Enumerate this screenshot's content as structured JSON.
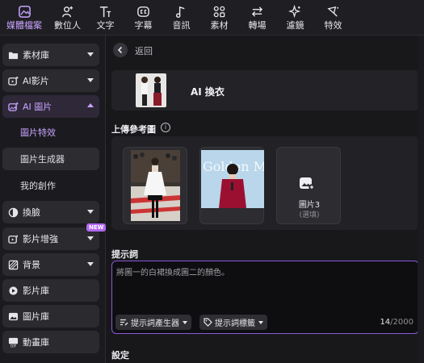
{
  "toolbar": {
    "items": [
      {
        "label": "媒體檔案",
        "icon": "media-icon",
        "active": true
      },
      {
        "label": "數位人",
        "icon": "avatar-add-icon"
      },
      {
        "label": "文字",
        "icon": "text-icon"
      },
      {
        "label": "字幕",
        "icon": "caption-icon"
      },
      {
        "label": "音訊",
        "icon": "music-note-icon"
      },
      {
        "label": "素材",
        "icon": "elements-icon"
      },
      {
        "label": "轉場",
        "icon": "transition-icon"
      },
      {
        "label": "濾鏡",
        "icon": "sparkle-icon"
      },
      {
        "label": "特效",
        "icon": "effects-icon"
      }
    ]
  },
  "sidebar": {
    "items": [
      {
        "label": "素材庫",
        "icon": "folder-icon"
      },
      {
        "label": "AI影片",
        "icon": "ai-video-icon"
      },
      {
        "label": "AI 圖片",
        "icon": "ai-image-icon"
      },
      {
        "label": "換臉",
        "icon": "face-swap-icon"
      },
      {
        "label": "影片增強",
        "icon": "enhance-icon",
        "badge": "NEW"
      },
      {
        "label": "背景",
        "icon": "background-icon"
      },
      {
        "label": "影片庫",
        "icon": "video-library-icon"
      },
      {
        "label": "圖片庫",
        "icon": "image-library-icon"
      },
      {
        "label": "動畫庫",
        "icon": "gif-icon"
      }
    ],
    "subitems": [
      {
        "label": "圖片特效"
      },
      {
        "label": "圖片生成器"
      },
      {
        "label": "我的創作"
      }
    ]
  },
  "main": {
    "back_label": "返回",
    "feature_title": "AI 換衣",
    "upload_title": "上傳參考圖",
    "slot3_label": "圖片3",
    "slot3_sub": "(選填)",
    "slot2_overlay_text": "Golden Music",
    "prompt_title": "提示詞",
    "prompt_value": "將圖一的白裙換成圖二的顏色。",
    "prompt_generator_label": "提示詞產生器",
    "prompt_tags_label": "提示詞標籤",
    "char_count": "14",
    "char_max": "/2000",
    "settings_title": "設定"
  },
  "colors": {
    "accent": "#c9a3ff",
    "badge": "#b268f2",
    "prompt_border": "#8a5ad8"
  }
}
